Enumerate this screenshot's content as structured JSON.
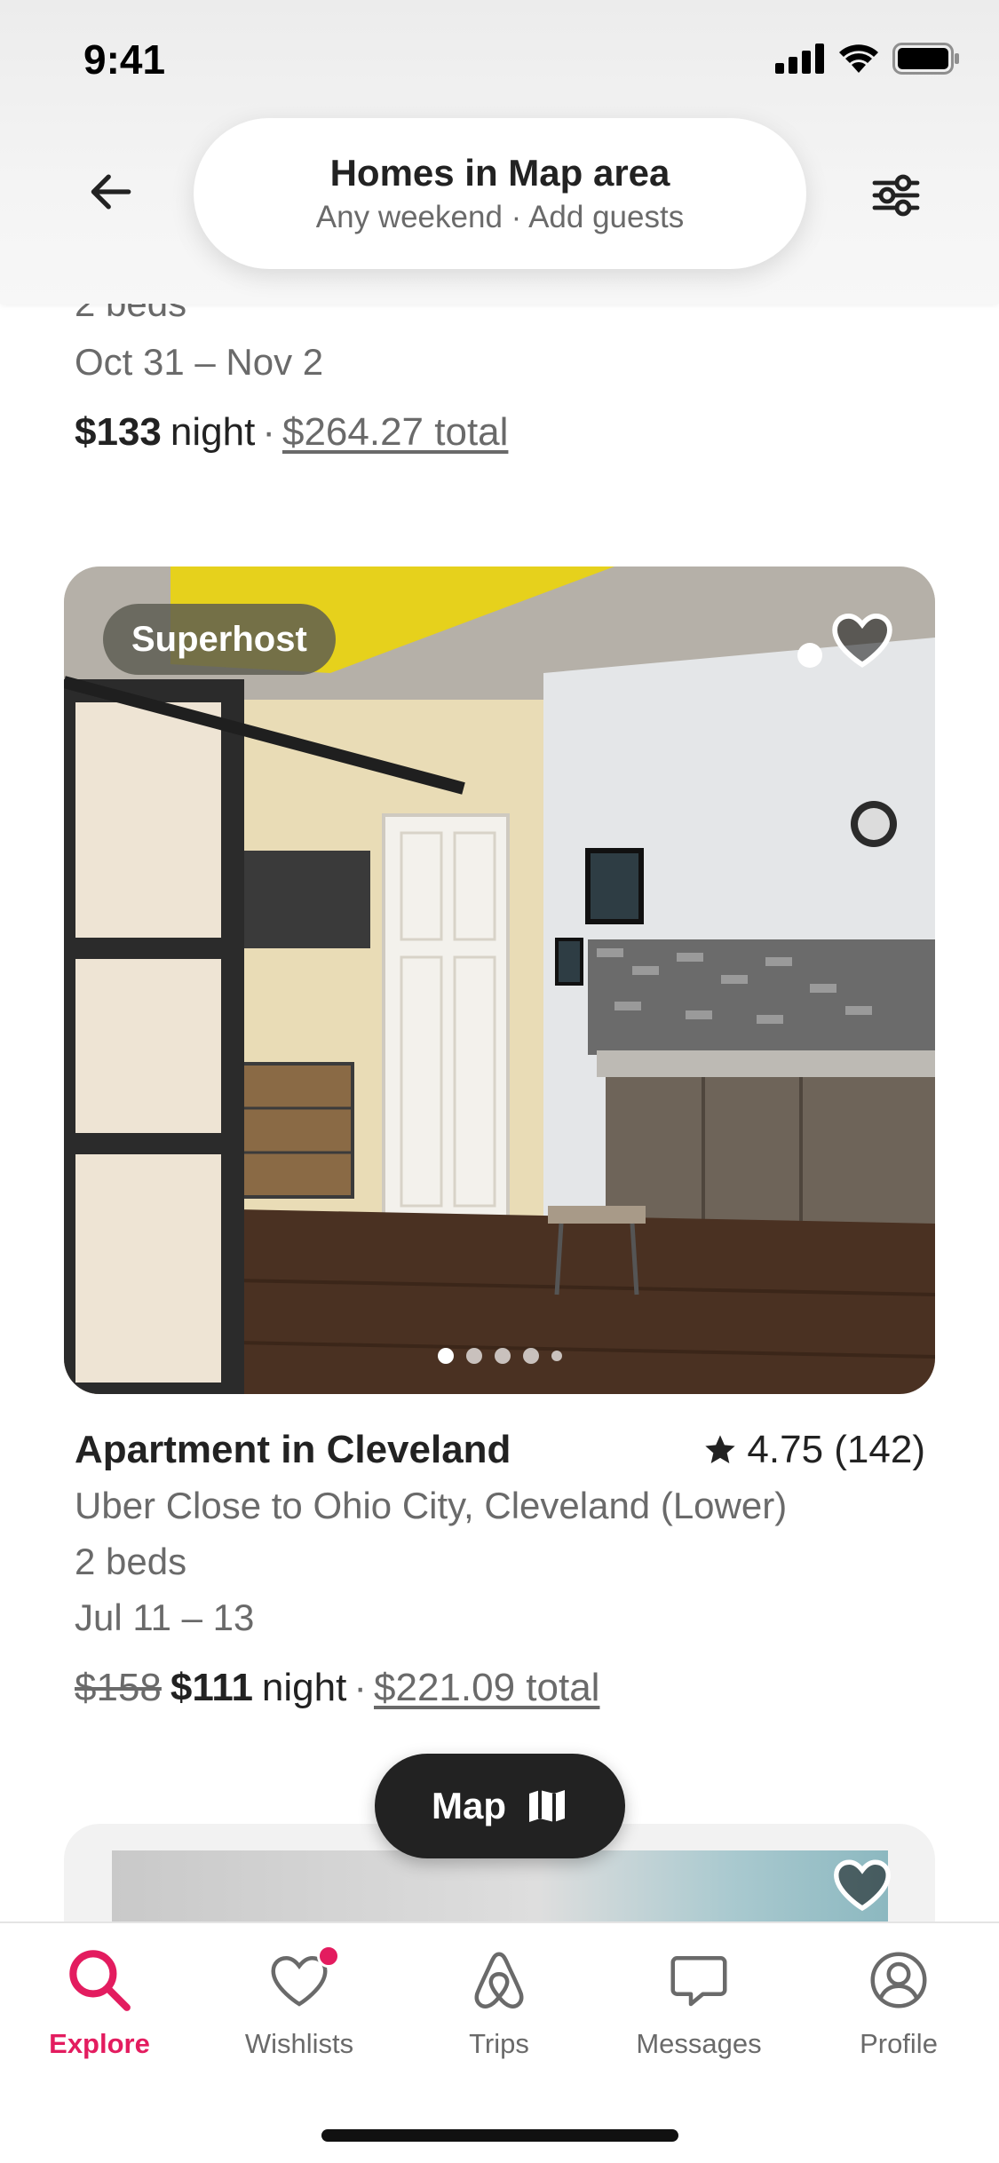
{
  "status_bar": {
    "time": "9:41"
  },
  "header": {
    "title": "Homes in Map area",
    "subtitle": "Any weekend · Add guests"
  },
  "previous_listing": {
    "beds": "2 beds",
    "dates": "Oct 31 – Nov 2",
    "price": "$133",
    "night_label": "night",
    "separator": "·",
    "total": "$264.27 total"
  },
  "listing": {
    "badge": "Superhost",
    "title": "Apartment in Cleveland",
    "rating": "4.75 (142)",
    "subtitle": "Uber Close to Ohio City, Cleveland (Lower)",
    "beds": "2 beds",
    "dates": "Jul 11 – 13",
    "original_price": "$158",
    "price": "$111",
    "night_label": "night",
    "separator": "·",
    "total": "$221.09 total",
    "photo_count_dots": 5,
    "active_photo_index": 0
  },
  "map_button": {
    "label": "Map"
  },
  "tabs": [
    {
      "label": "Explore",
      "icon": "search-icon",
      "active": true
    },
    {
      "label": "Wishlists",
      "icon": "heart-icon",
      "active": false,
      "has_notification": true
    },
    {
      "label": "Trips",
      "icon": "airbnb-logo-icon",
      "active": false
    },
    {
      "label": "Messages",
      "icon": "message-icon",
      "active": false
    },
    {
      "label": "Profile",
      "icon": "profile-icon",
      "active": false
    }
  ],
  "colors": {
    "accent": "#E31C5F",
    "text_primary": "#222222",
    "text_secondary": "#6A6A6A",
    "map_button_bg": "#222222"
  }
}
